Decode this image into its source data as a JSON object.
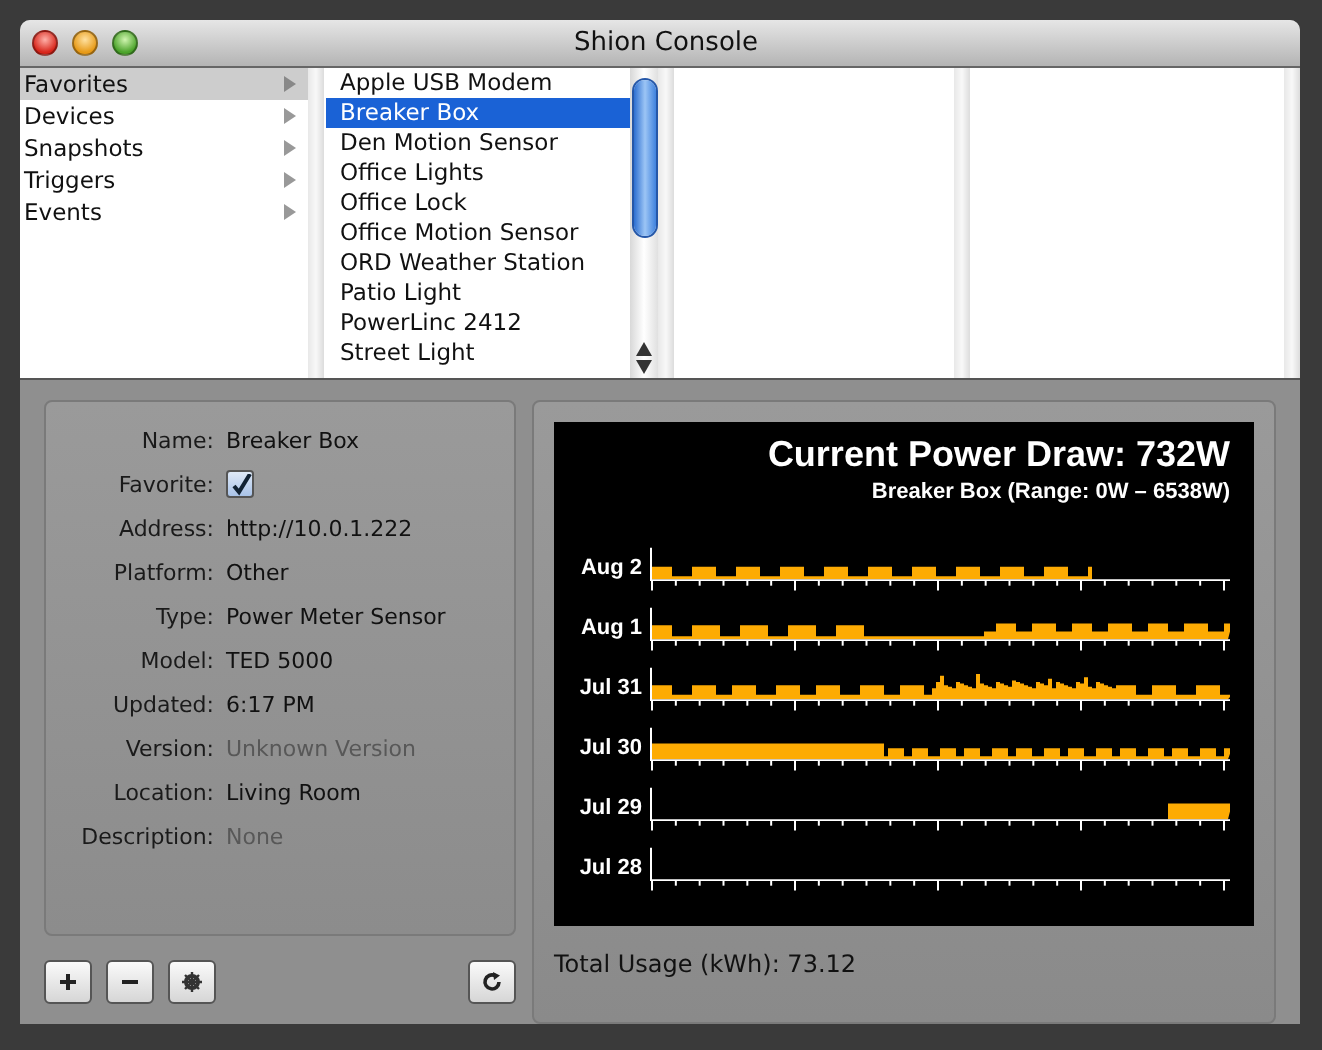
{
  "window": {
    "title": "Shion Console"
  },
  "categories": [
    {
      "label": "Favorites",
      "selected": true
    },
    {
      "label": "Devices",
      "selected": false
    },
    {
      "label": "Snapshots",
      "selected": false
    },
    {
      "label": "Triggers",
      "selected": false
    },
    {
      "label": "Events",
      "selected": false
    }
  ],
  "devices": [
    {
      "label": "Apple USB Modem",
      "selected": false
    },
    {
      "label": "Breaker Box",
      "selected": true
    },
    {
      "label": "Den Motion Sensor",
      "selected": false
    },
    {
      "label": "Office Lights",
      "selected": false
    },
    {
      "label": "Office Lock",
      "selected": false
    },
    {
      "label": "Office Motion Sensor",
      "selected": false
    },
    {
      "label": "ORD Weather Station",
      "selected": false
    },
    {
      "label": "Patio Light",
      "selected": false
    },
    {
      "label": "PowerLinc 2412",
      "selected": false
    },
    {
      "label": "Street Light",
      "selected": false
    }
  ],
  "details": [
    {
      "kind": "text",
      "label": "Name:",
      "value": "Breaker Box",
      "disabled": false
    },
    {
      "kind": "checkbox",
      "label": "Favorite:",
      "checked": true
    },
    {
      "kind": "text",
      "label": "Address:",
      "value": "http://10.0.1.222",
      "disabled": false
    },
    {
      "kind": "text",
      "label": "Platform:",
      "value": "Other",
      "disabled": false
    },
    {
      "kind": "text",
      "label": "Type:",
      "value": "Power Meter Sensor",
      "disabled": false
    },
    {
      "kind": "text",
      "label": "Model:",
      "value": "TED 5000",
      "disabled": false
    },
    {
      "kind": "text",
      "label": "Updated:",
      "value": "6:17 PM",
      "disabled": false
    },
    {
      "kind": "text",
      "label": "Version:",
      "value": "Unknown Version",
      "disabled": true
    },
    {
      "kind": "text",
      "label": "Location:",
      "value": "Living Room",
      "disabled": false
    },
    {
      "kind": "text",
      "label": "Description:",
      "value": "None",
      "disabled": true
    }
  ],
  "chart": {
    "title": "Current Power Draw: 732W",
    "subtitle": "Breaker Box (Range: 0W – 6538W)",
    "rows": [
      {
        "label": "Aug 2"
      },
      {
        "label": "Aug 1"
      },
      {
        "label": "Jul 31"
      },
      {
        "label": "Jul 30"
      },
      {
        "label": "Jul 29"
      },
      {
        "label": "Jul 28"
      }
    ]
  },
  "total_usage": "Total Usage (kWh): 73.12"
}
